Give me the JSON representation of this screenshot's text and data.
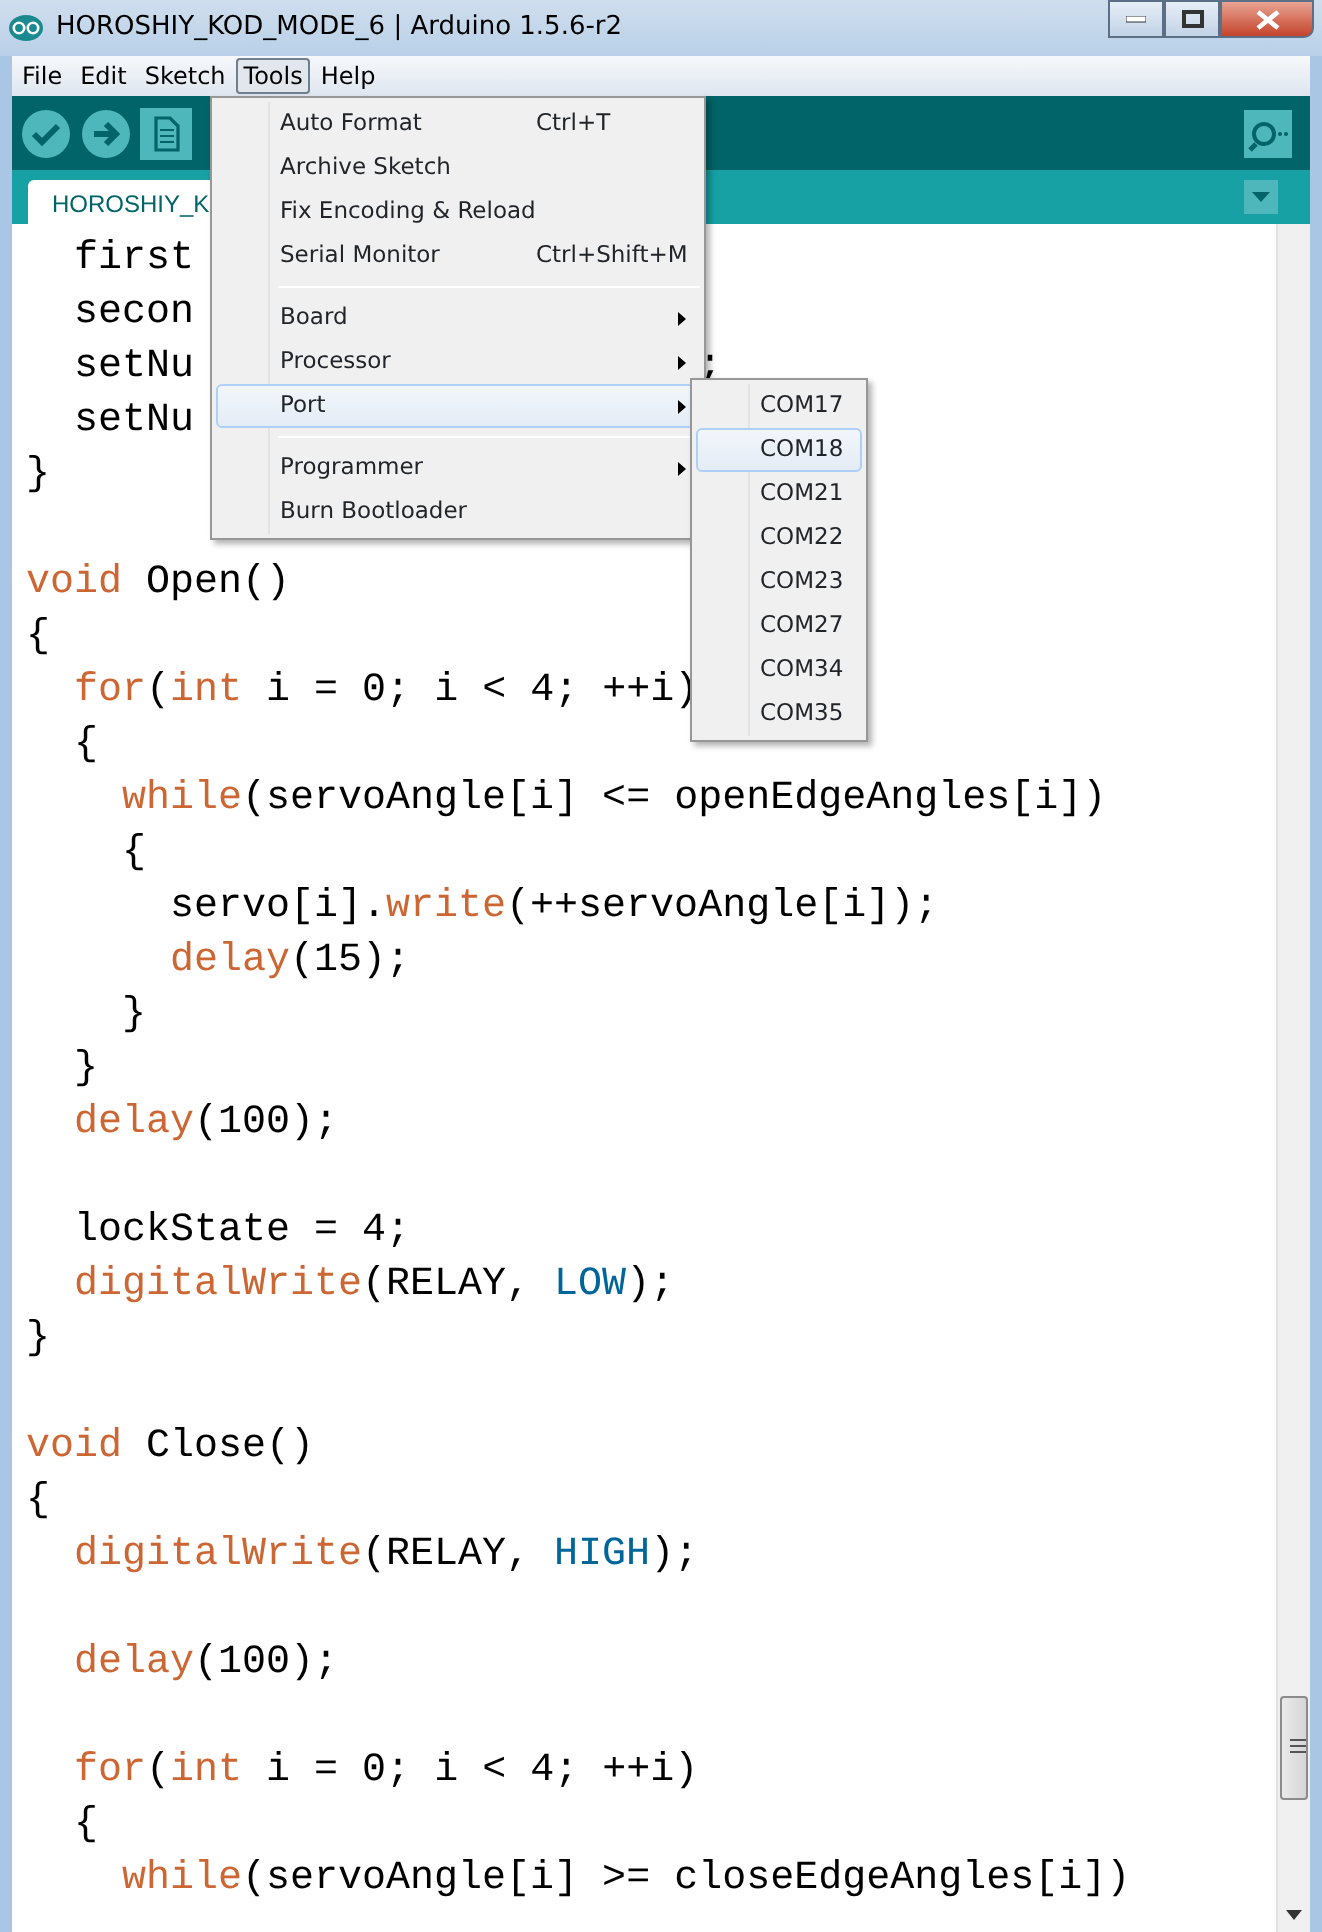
{
  "window": {
    "title": "HOROSHIY_KOD_MODE_6 | Arduino 1.5.6-r2"
  },
  "menu_bar": [
    {
      "label": "File",
      "selected": false
    },
    {
      "label": "Edit",
      "selected": false
    },
    {
      "label": "Sketch",
      "selected": false
    },
    {
      "label": "Tools",
      "selected": true
    },
    {
      "label": "Help",
      "selected": false
    }
  ],
  "tabs": [
    {
      "label": "HOROSHIY_K",
      "selected": true
    }
  ],
  "tools_menu": [
    {
      "kind": "item",
      "label": "Auto Format",
      "shortcut": "Ctrl+T",
      "submenu": false,
      "selected": false
    },
    {
      "kind": "item",
      "label": "Archive Sketch",
      "submenu": false,
      "selected": false
    },
    {
      "kind": "item",
      "label": "Fix Encoding & Reload",
      "submenu": false,
      "selected": false
    },
    {
      "kind": "item",
      "label": "Serial Monitor",
      "shortcut": "Ctrl+Shift+M",
      "submenu": false,
      "selected": false
    },
    {
      "kind": "separator"
    },
    {
      "kind": "item",
      "label": "Board",
      "submenu": true,
      "selected": false
    },
    {
      "kind": "item",
      "label": "Processor",
      "submenu": true,
      "selected": false
    },
    {
      "kind": "item",
      "label": "Port",
      "submenu": true,
      "selected": true
    },
    {
      "kind": "separator"
    },
    {
      "kind": "item",
      "label": "Programmer",
      "submenu": true,
      "selected": false
    },
    {
      "kind": "item",
      "label": "Burn Bootloader",
      "submenu": false,
      "selected": false
    }
  ],
  "port_menu": [
    {
      "label": "COM17",
      "selected": false
    },
    {
      "label": "COM18",
      "selected": true
    },
    {
      "label": "COM21",
      "selected": false
    },
    {
      "label": "COM22",
      "selected": false
    },
    {
      "label": "COM23",
      "selected": false
    },
    {
      "label": "COM27",
      "selected": false
    },
    {
      "label": "COM34",
      "selected": false
    },
    {
      "label": "COM35",
      "selected": false
    }
  ],
  "editor": {
    "lines": [
      {
        "kind": "code",
        "tokens": [
          {
            "text": "  first",
            "kind": "plain"
          }
        ]
      },
      {
        "kind": "code",
        "tokens": [
          {
            "text": "  secon",
            "kind": "plain"
          }
        ]
      },
      {
        "kind": "code",
        "tokens": [
          {
            "text": "  setNu",
            "kind": "plain"
          }
        ],
        "tail": ";"
      },
      {
        "kind": "code",
        "tokens": [
          {
            "text": "  setNu",
            "kind": "plain"
          }
        ]
      },
      {
        "kind": "code",
        "tokens": [
          {
            "text": "}",
            "kind": "plain"
          }
        ]
      },
      {
        "kind": "blank"
      },
      {
        "kind": "code",
        "tokens": [
          {
            "text": "void",
            "kind": "keyword"
          },
          {
            "text": " Open()",
            "kind": "plain"
          }
        ]
      },
      {
        "kind": "code",
        "tokens": [
          {
            "text": "{",
            "kind": "plain"
          }
        ]
      },
      {
        "kind": "code",
        "tokens": [
          {
            "text": "  for",
            "kind": "keyword"
          },
          {
            "text": "(",
            "kind": "plain"
          },
          {
            "text": "int",
            "kind": "keyword"
          },
          {
            "text": " i = 0; i < 4; ++i)",
            "kind": "plain"
          }
        ]
      },
      {
        "kind": "code",
        "tokens": [
          {
            "text": "  {",
            "kind": "plain"
          }
        ]
      },
      {
        "kind": "code",
        "tokens": [
          {
            "text": "    while",
            "kind": "keyword"
          },
          {
            "text": "(servoAngle[i] <= openEdgeAngles[i])",
            "kind": "plain"
          }
        ]
      },
      {
        "kind": "code",
        "tokens": [
          {
            "text": "    {",
            "kind": "plain"
          }
        ]
      },
      {
        "kind": "code",
        "tokens": [
          {
            "text": "      servo[i].",
            "kind": "plain"
          },
          {
            "text": "write",
            "kind": "keyword"
          },
          {
            "text": "(++servoAngle[i]);",
            "kind": "plain"
          }
        ]
      },
      {
        "kind": "code",
        "tokens": [
          {
            "text": "      delay",
            "kind": "keyword"
          },
          {
            "text": "(15);",
            "kind": "plain"
          }
        ]
      },
      {
        "kind": "code",
        "tokens": [
          {
            "text": "    }",
            "kind": "plain"
          }
        ]
      },
      {
        "kind": "code",
        "tokens": [
          {
            "text": "  }",
            "kind": "plain"
          }
        ]
      },
      {
        "kind": "code",
        "tokens": [
          {
            "text": "  delay",
            "kind": "keyword"
          },
          {
            "text": "(100);",
            "kind": "plain"
          }
        ]
      },
      {
        "kind": "blank"
      },
      {
        "kind": "code",
        "tokens": [
          {
            "text": "  lockState = 4;",
            "kind": "plain"
          }
        ]
      },
      {
        "kind": "code",
        "tokens": [
          {
            "text": "  digitalWrite",
            "kind": "keyword"
          },
          {
            "text": "(RELAY, ",
            "kind": "plain"
          },
          {
            "text": "LOW",
            "kind": "constant"
          },
          {
            "text": ");",
            "kind": "plain"
          }
        ]
      },
      {
        "kind": "code",
        "tokens": [
          {
            "text": "}",
            "kind": "plain"
          }
        ]
      },
      {
        "kind": "blank"
      },
      {
        "kind": "code",
        "tokens": [
          {
            "text": "void",
            "kind": "keyword"
          },
          {
            "text": " Close()",
            "kind": "plain"
          }
        ]
      },
      {
        "kind": "code",
        "tokens": [
          {
            "text": "{",
            "kind": "plain"
          }
        ]
      },
      {
        "kind": "code",
        "tokens": [
          {
            "text": "  digitalWrite",
            "kind": "keyword"
          },
          {
            "text": "(RELAY, ",
            "kind": "plain"
          },
          {
            "text": "HIGH",
            "kind": "constant"
          },
          {
            "text": ");",
            "kind": "plain"
          }
        ]
      },
      {
        "kind": "blank"
      },
      {
        "kind": "code",
        "tokens": [
          {
            "text": "  delay",
            "kind": "keyword"
          },
          {
            "text": "(100);",
            "kind": "plain"
          }
        ]
      },
      {
        "kind": "blank"
      },
      {
        "kind": "code",
        "tokens": [
          {
            "text": "  for",
            "kind": "keyword"
          },
          {
            "text": "(",
            "kind": "plain"
          },
          {
            "text": "int",
            "kind": "keyword"
          },
          {
            "text": " i = 0; i < 4; ++i)",
            "kind": "plain"
          }
        ]
      },
      {
        "kind": "code",
        "tokens": [
          {
            "text": "  {",
            "kind": "plain"
          }
        ]
      },
      {
        "kind": "code",
        "tokens": [
          {
            "text": "    while",
            "kind": "keyword"
          },
          {
            "text": "(servoAngle[i] >= closeEdgeAngles[i])",
            "kind": "plain"
          }
        ]
      }
    ]
  }
}
